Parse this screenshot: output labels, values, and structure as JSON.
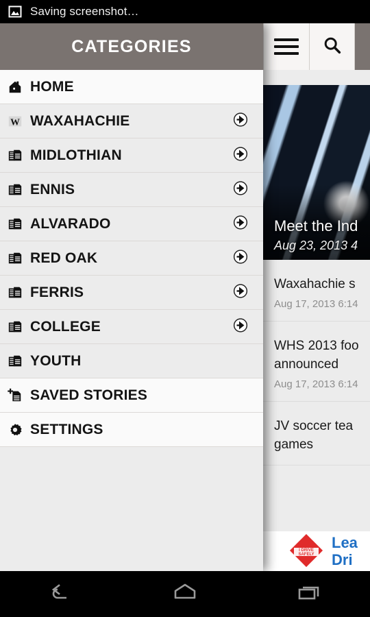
{
  "statusbar": {
    "icon": "image-icon",
    "text": "Saving screenshot…"
  },
  "actionbar": {
    "menu_icon": "hamburger-icon",
    "search_icon": "search-icon"
  },
  "drawer": {
    "title": "CATEGORIES",
    "items": [
      {
        "label": "HOME",
        "icon": "home-icon",
        "has_arrow": false,
        "highlighted": true
      },
      {
        "label": "WAXAHACHIE",
        "icon": "w-logo-icon",
        "has_arrow": true,
        "highlighted": false
      },
      {
        "label": "MIDLOTHIAN",
        "icon": "newspaper-icon",
        "has_arrow": true,
        "highlighted": false
      },
      {
        "label": "ENNIS",
        "icon": "newspaper-icon",
        "has_arrow": true,
        "highlighted": false
      },
      {
        "label": "ALVARADO",
        "icon": "newspaper-icon",
        "has_arrow": true,
        "highlighted": false
      },
      {
        "label": "RED OAK",
        "icon": "newspaper-icon",
        "has_arrow": true,
        "highlighted": false
      },
      {
        "label": "FERRIS",
        "icon": "newspaper-icon",
        "has_arrow": true,
        "highlighted": false
      },
      {
        "label": "COLLEGE",
        "icon": "newspaper-icon",
        "has_arrow": true,
        "highlighted": false
      },
      {
        "label": "YOUTH",
        "icon": "newspaper-icon",
        "has_arrow": false,
        "highlighted": false
      },
      {
        "label": "SAVED STORIES",
        "icon": "save-document-icon",
        "has_arrow": false,
        "highlighted": true
      },
      {
        "label": "SETTINGS",
        "icon": "gear-icon",
        "has_arrow": false,
        "highlighted": true
      }
    ]
  },
  "hero": {
    "title": "Meet the Ind",
    "date": "Aug 23, 2013 4"
  },
  "articles": [
    {
      "title": "Waxahachie s",
      "title2": "",
      "date": "Aug 17, 2013 6:14"
    },
    {
      "title": "WHS 2013 foo",
      "title2": "announced",
      "date": "Aug 17, 2013 6:14"
    },
    {
      "title": "JV soccer tea",
      "title2": "games",
      "date": ""
    }
  ],
  "ad": {
    "badge_line1": "I DRIVE",
    "badge_line2": "SAFELY",
    "line1": "Lea",
    "line2": "Dri",
    "accent_color": "#1f6fc4",
    "badge_color": "#e02b2b"
  },
  "navbar": {
    "back": "back-icon",
    "home": "home-nav-icon",
    "recents": "recent-apps-icon"
  }
}
